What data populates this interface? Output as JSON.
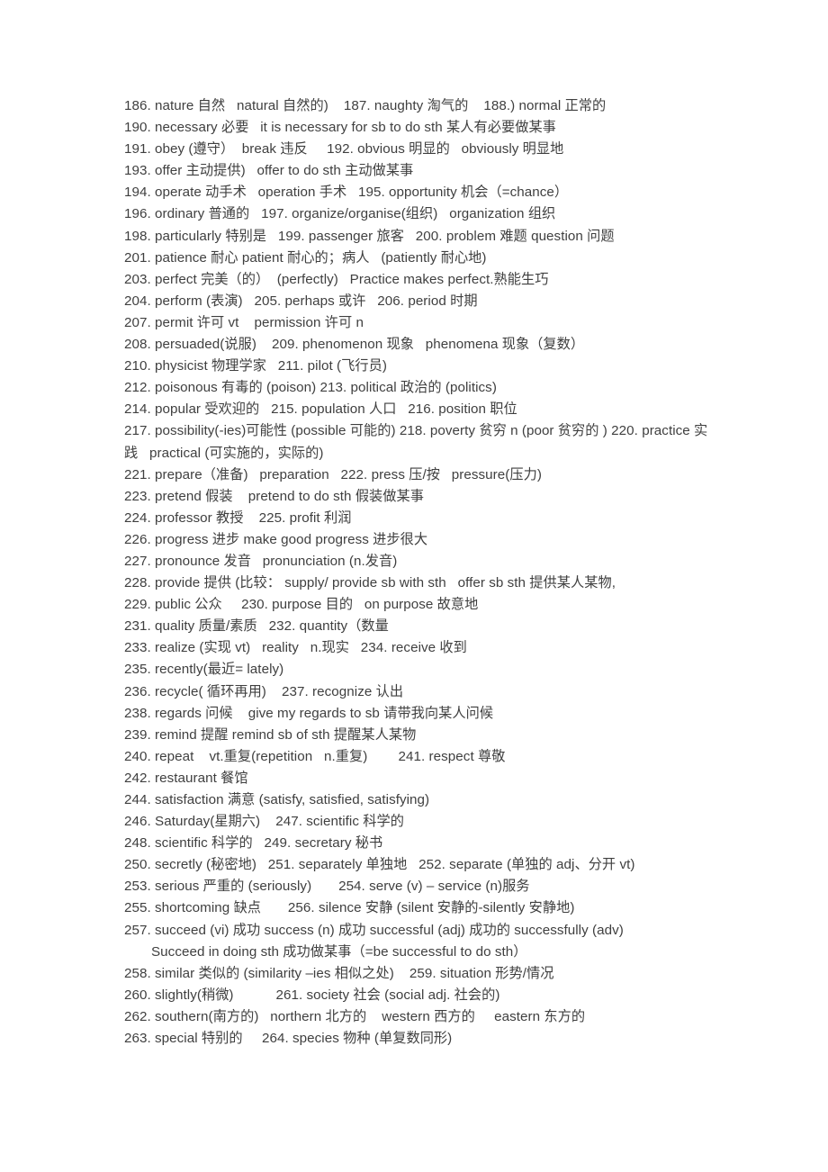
{
  "document": {
    "type": "vocabulary-list",
    "language": "zh-CN/en",
    "text_color": "#3f3f3f",
    "background_color": "#ffffff",
    "lines": [
      {
        "id": "line-186",
        "indent": false,
        "text": "186. nature 自然   natural 自然的)    187. naughty 淘气的    188.) normal 正常的"
      },
      {
        "id": "line-190",
        "indent": false,
        "text": "190. necessary 必要   it is necessary for sb to do sth 某人有必要做某事"
      },
      {
        "id": "line-191",
        "indent": false,
        "text": "191. obey (遵守）  break 违反     192. obvious 明显的   obviously 明显地"
      },
      {
        "id": "line-193",
        "indent": false,
        "text": "193. offer 主动提供)   offer to do sth 主动做某事"
      },
      {
        "id": "line-194",
        "indent": false,
        "text": "194. operate 动手术   operation 手术   195. opportunity 机会（=chance）"
      },
      {
        "id": "line-196",
        "indent": false,
        "text": "196. ordinary 普通的   197. organize/organise(组织)   organization 组织"
      },
      {
        "id": "line-198",
        "indent": false,
        "text": "198. particularly 特别是   199. passenger 旅客   200. problem 难题 question 问题"
      },
      {
        "id": "line-201",
        "indent": false,
        "text": "201. patience 耐心 patient 耐心的；病人   (patiently 耐心地)"
      },
      {
        "id": "line-203",
        "indent": false,
        "text": "203. perfect 完美（的）  (perfectly)   Practice makes perfect.熟能生巧"
      },
      {
        "id": "line-204",
        "indent": false,
        "text": "204. perform (表演)   205. perhaps 或许   206. period 时期"
      },
      {
        "id": "line-207",
        "indent": false,
        "text": "207. permit 许可 vt    permission 许可 n"
      },
      {
        "id": "line-208",
        "indent": false,
        "text": "208. persuaded(说服)    209. phenomenon 现象   phenomena 现象（复数）"
      },
      {
        "id": "line-210",
        "indent": false,
        "text": "210. physicist 物理学家   211. pilot (飞行员)"
      },
      {
        "id": "line-212",
        "indent": false,
        "text": "212. poisonous 有毒的 (poison) 213. political 政治的 (politics)"
      },
      {
        "id": "line-214",
        "indent": false,
        "text": "214. popular 受欢迎的   215. population 人口   216. position 职位"
      },
      {
        "id": "line-217",
        "indent": false,
        "text": "217. possibility(-ies)可能性 (possible 可能的) 218. poverty 贫穷 n (poor 贫穷的 ) 220. practice 实践   practical (可实施的，实际的)"
      },
      {
        "id": "line-221",
        "indent": false,
        "text": "221. prepare（准备)   preparation   222. press 压/按   pressure(压力)"
      },
      {
        "id": "line-223",
        "indent": false,
        "text": "223. pretend 假装    pretend to do sth 假装做某事"
      },
      {
        "id": "line-224",
        "indent": false,
        "text": "224. professor 教授    225. profit 利润"
      },
      {
        "id": "line-226",
        "indent": false,
        "text": "226. progress 进步 make good progress 进步很大"
      },
      {
        "id": "line-227",
        "indent": false,
        "text": "227. pronounce 发音   pronunciation (n.发音)"
      },
      {
        "id": "line-228",
        "indent": false,
        "text": "228. provide 提供 (比较： supply/ provide sb with sth   offer sb sth 提供某人某物,"
      },
      {
        "id": "line-229",
        "indent": false,
        "text": "229. public 公众     230. purpose 目的   on purpose 故意地"
      },
      {
        "id": "line-231",
        "indent": false,
        "text": "231. quality 质量/素质   232. quantity（数量"
      },
      {
        "id": "line-233",
        "indent": false,
        "text": "233. realize (实现 vt)   reality   n.现实   234. receive 收到"
      },
      {
        "id": "line-235",
        "indent": false,
        "text": "235. recently(最近= lately)"
      },
      {
        "id": "line-236",
        "indent": false,
        "text": "236. recycle( 循环再用)    237. recognize 认出"
      },
      {
        "id": "line-238",
        "indent": false,
        "text": "238. regards 问候    give my regards to sb 请带我向某人问候"
      },
      {
        "id": "line-239",
        "indent": false,
        "text": "239. remind 提醒 remind sb of sth 提醒某人某物"
      },
      {
        "id": "line-240",
        "indent": false,
        "text": "240. repeat    vt.重复(repetition   n.重复)        241. respect 尊敬"
      },
      {
        "id": "line-242",
        "indent": false,
        "text": "242. restaurant 餐馆"
      },
      {
        "id": "line-244",
        "indent": false,
        "text": "244. satisfaction 满意 (satisfy, satisfied, satisfying)"
      },
      {
        "id": "line-246",
        "indent": false,
        "text": "246. Saturday(星期六)    247. scientific 科学的"
      },
      {
        "id": "line-248",
        "indent": false,
        "text": "248. scientific 科学的   249. secretary 秘书"
      },
      {
        "id": "line-250",
        "indent": false,
        "text": "250. secretly (秘密地)   251. separately 单独地   252. separate (单独的 adj、分开 vt)"
      },
      {
        "id": "line-253",
        "indent": false,
        "text": "253. serious 严重的 (seriously)       254. serve (v) – service (n)服务"
      },
      {
        "id": "line-255",
        "indent": false,
        "text": "255. shortcoming 缺点       256. silence 安静 (silent 安静的-silently 安静地)"
      },
      {
        "id": "line-257",
        "indent": false,
        "text": "257. succeed (vi) 成功 success (n) 成功 successful (adj) 成功的 successfully (adv)"
      },
      {
        "id": "line-257b",
        "indent": true,
        "text": "Succeed in doing sth 成功做某事（=be successful to do sth）"
      },
      {
        "id": "line-258",
        "indent": false,
        "text": "258. similar 类似的 (similarity –ies 相似之处)    259. situation 形势/情况"
      },
      {
        "id": "line-260",
        "indent": false,
        "text": "260. slightly(稍微)           261. society 社会 (social adj. 社会的)"
      },
      {
        "id": "line-262",
        "indent": false,
        "text": "262. southern(南方的)   northern 北方的    western 西方的     eastern 东方的"
      },
      {
        "id": "line-263",
        "indent": false,
        "text": "263. special 特别的     264. species 物种 (单复数同形)"
      }
    ]
  }
}
